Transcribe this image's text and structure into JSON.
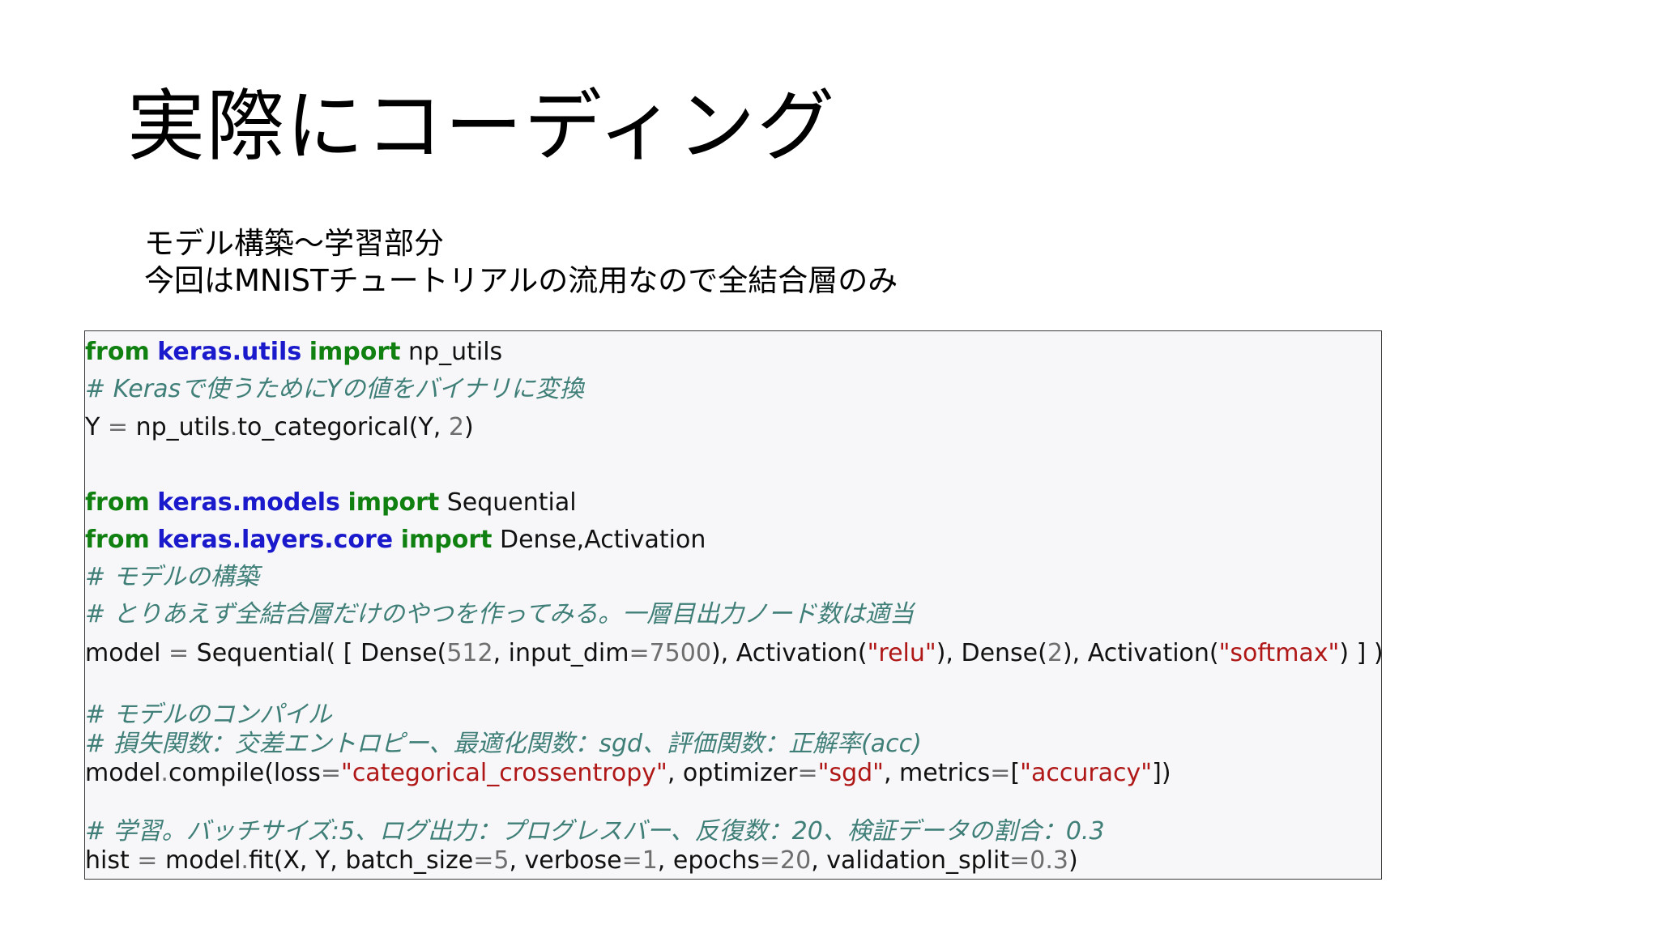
{
  "slide": {
    "title": "実際にコーディング",
    "subtitle_lines": [
      "モデル構築〜学習部分",
      "今回はMNISTチュートリアルの流用なので全結合層のみ"
    ]
  },
  "code": {
    "line1": {
      "kw1": "from",
      "mod": "keras.utils",
      "kw2": "import",
      "name": "np_utils"
    },
    "line2": {
      "comment": "# Kerasで使うためにYの値をバイナリに変換"
    },
    "line3": {
      "a": "Y",
      "eq": "=",
      "b": "np_utils",
      "dot": ".",
      "c": "to_categorical(Y,",
      "num": "2",
      "d": ")"
    },
    "line4": {
      "kw1": "from",
      "mod": "keras.models",
      "kw2": "import",
      "name": "Sequential"
    },
    "line5": {
      "kw1": "from",
      "mod": "keras.layers.core",
      "kw2": "import",
      "name": "Dense,Activation"
    },
    "line6": {
      "comment": "# モデルの構築"
    },
    "line7": {
      "comment": "# とりあえず全結合層だけのやつを作ってみる。一層目出力ノード数は適当"
    },
    "line8": {
      "a": "model",
      "eq1": "=",
      "b": "Sequential( [ Dense(",
      "n1": "512",
      "c": ", input_dim",
      "eq2": "=",
      "n2": "7500",
      "d": "), Activation(",
      "s1": "\"relu\"",
      "e": "), Dense(",
      "n3": "2",
      "f": "), Activation(",
      "s2": "\"softmax\"",
      "g": ") ] )"
    },
    "line9": {
      "comment": "# モデルのコンパイル"
    },
    "line10": {
      "comment": "# 損失関数：交差エントロピー、最適化関数：sgd、評価関数：正解率(acc)"
    },
    "line11": {
      "a": "model",
      "dot": ".",
      "b": "compile(loss",
      "eq1": "=",
      "s1": "\"categorical_crossentropy\"",
      "c": ", optimizer",
      "eq2": "=",
      "s2": "\"sgd\"",
      "d": ", metrics",
      "eq3": "=",
      "e": "[",
      "s3": "\"accuracy\"",
      "f": "])"
    },
    "line12": {
      "comment": "# 学習。バッチサイズ:5、ログ出力：プログレスバー、反復数：20、検証データの割合：0.3"
    },
    "line13": {
      "a": "hist",
      "eq1": "=",
      "b": "model",
      "dot": ".",
      "c": "fit(X, Y, batch_size",
      "eq2": "=",
      "n1": "5",
      "d": ", verbose",
      "eq3": "=",
      "n2": "1",
      "e": ", epochs",
      "eq4": "=",
      "n3": "20",
      "f": ", validation_split",
      "eq5": "=",
      "n4": "0.3",
      "g": ")"
    }
  },
  "colors": {
    "keyword": "#108010",
    "module": "#1a1acc",
    "comment": "#3f7f78",
    "string": "#b01818",
    "number": "#6e6e6e"
  }
}
